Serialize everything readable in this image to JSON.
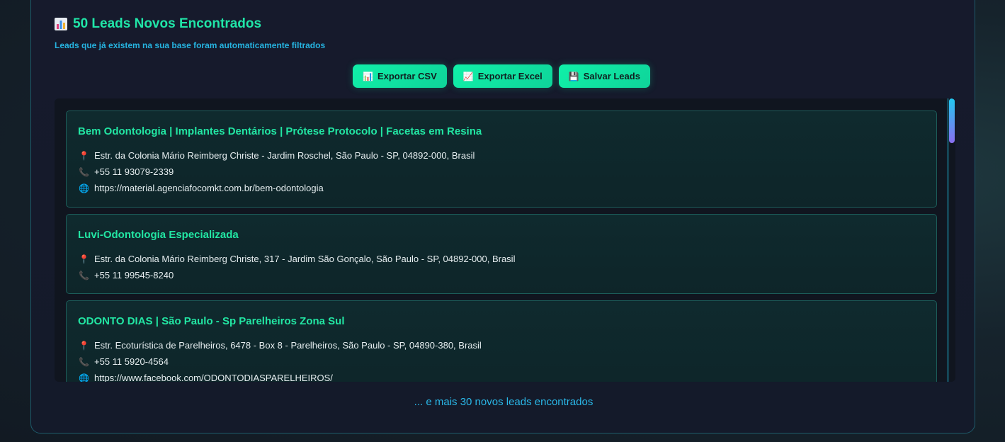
{
  "header": {
    "title": "50 Leads Novos Encontrados",
    "subtitle": "Leads que já existem na sua base foram automaticamente filtrados"
  },
  "buttons": {
    "export_csv": "Exportar CSV",
    "export_excel": "Exportar Excel",
    "save_leads": "Salvar Leads"
  },
  "leads": [
    {
      "name": "Bem Odontologia | Implantes Dentários | Prótese Protocolo | Facetas em Resina",
      "address": "Estr. da Colonia Mário Reimberg Christe - Jardim Roschel, São Paulo - SP, 04892-000, Brasil",
      "phone": "+55 11 93079-2339",
      "website": "https://material.agenciafocomkt.com.br/bem-odontologia"
    },
    {
      "name": "Luvi-Odontologia Especializada",
      "address": "Estr. da Colonia Mário Reimberg Christe, 317 - Jardim São Gonçalo, São Paulo - SP, 04892-000, Brasil",
      "phone": "+55 11 99545-8240"
    },
    {
      "name": "ODONTO DIAS | São Paulo - Sp Parelheiros Zona Sul",
      "address": "Estr. Ecoturística de Parelheiros, 6478 - Box 8 - Parelheiros, São Paulo - SP, 04890-380, Brasil",
      "phone": "+55 11 5920-4564",
      "website": "https://www.facebook.com/ODONTODIASPARELHEIROS/"
    }
  ],
  "footer": {
    "more_text": "... e mais 30 novos leads encontrados"
  },
  "icons": {
    "title": "bar-chart-icon",
    "csv": "bar-chart-icon",
    "excel": "line-chart-icon",
    "save": "floppy-disk-icon",
    "address": "map-pin-icon",
    "phone": "phone-icon",
    "website": "globe-icon"
  },
  "colors": {
    "accent": "#20e6a8",
    "subtitle": "#26b3e0",
    "button": "#10f0a8",
    "panel_bg": "#161a2c",
    "card_bg": "#0f2a2e"
  }
}
